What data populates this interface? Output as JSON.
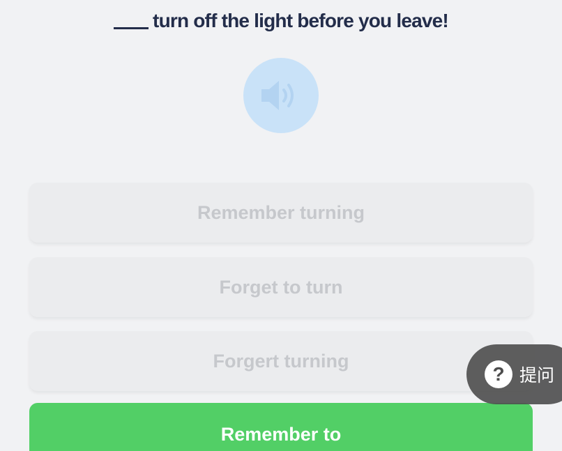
{
  "question": {
    "blank": "____",
    "text": "turn off the light before you leave!"
  },
  "audio": {
    "icon": "speaker-icon",
    "color": "#c9e2f8"
  },
  "options": [
    {
      "label": "Remember turning",
      "state": "disabled"
    },
    {
      "label": "Forget to turn",
      "state": "disabled"
    },
    {
      "label": "Forgert turning",
      "state": "disabled"
    },
    {
      "label": "Remember to",
      "state": "correct"
    }
  ],
  "ask_button": {
    "icon": "question-icon",
    "icon_glyph": "?",
    "label": "提问"
  },
  "colors": {
    "background": "#f1f2f4",
    "question_text": "#232d4a",
    "option_disabled_bg": "#ebecee",
    "option_disabled_text": "#c6c8cc",
    "correct": "#52cf66"
  }
}
